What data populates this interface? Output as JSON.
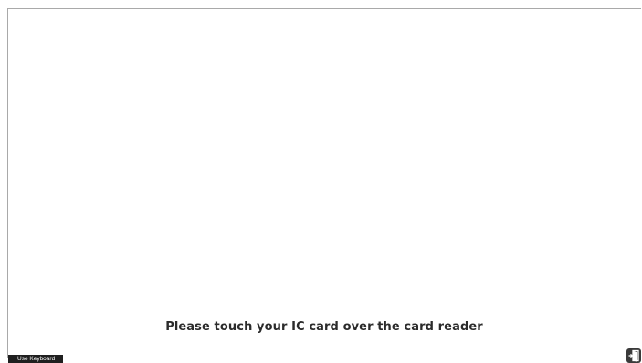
{
  "main": {
    "prompt_text": "Please touch your IC card over the card reader"
  },
  "footer": {
    "keyboard_button_label": "Use Keyboard",
    "exit_icon": "exit-door-icon"
  }
}
